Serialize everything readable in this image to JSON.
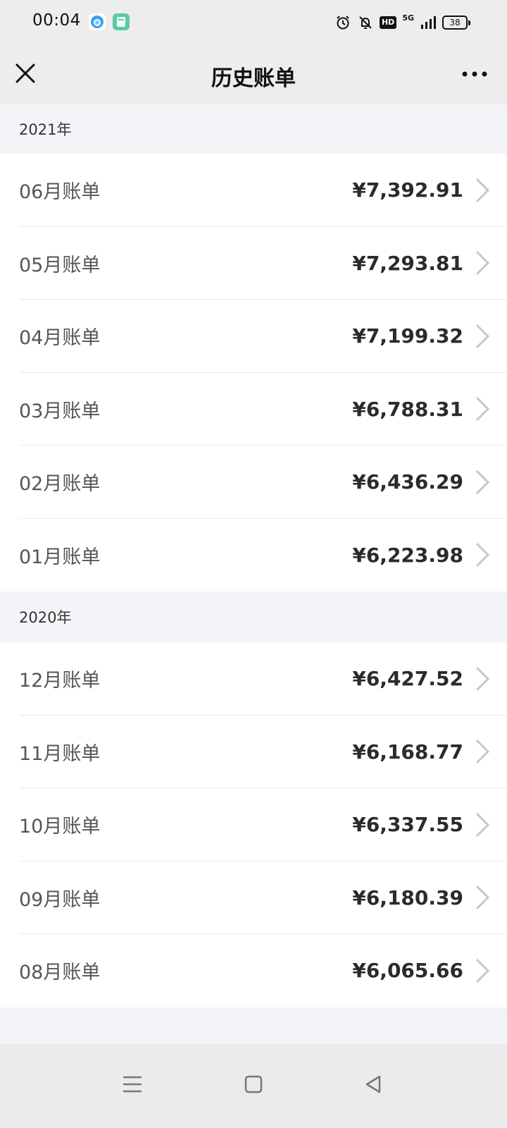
{
  "status_bar": {
    "time": "00:04",
    "network": "5G",
    "hd": "HD",
    "battery": "38"
  },
  "nav": {
    "title": "历史账单"
  },
  "sections": [
    {
      "year": "2021年",
      "bills": [
        {
          "label": "06月账单",
          "amount": "¥7,392.91"
        },
        {
          "label": "05月账单",
          "amount": "¥7,293.81"
        },
        {
          "label": "04月账单",
          "amount": "¥7,199.32"
        },
        {
          "label": "03月账单",
          "amount": "¥6,788.31"
        },
        {
          "label": "02月账单",
          "amount": "¥6,436.29"
        },
        {
          "label": "01月账单",
          "amount": "¥6,223.98"
        }
      ]
    },
    {
      "year": "2020年",
      "bills": [
        {
          "label": "12月账单",
          "amount": "¥6,427.52"
        },
        {
          "label": "11月账单",
          "amount": "¥6,168.77"
        },
        {
          "label": "10月账单",
          "amount": "¥6,337.55"
        },
        {
          "label": "09月账单",
          "amount": "¥6,180.39"
        },
        {
          "label": "08月账单",
          "amount": "¥6,065.66"
        }
      ]
    }
  ],
  "colors": {
    "header_bg": "#ededed",
    "page_bg": "#f3f4f7",
    "row_bg": "#ffffff",
    "amount_text": "#2b2b2b",
    "label_text": "#555555"
  }
}
